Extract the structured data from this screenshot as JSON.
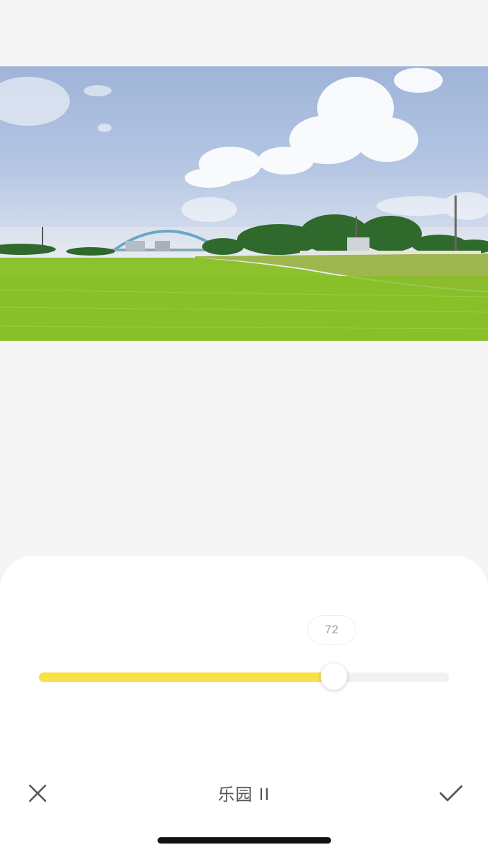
{
  "photo": {
    "description_icon": "landscape-photo"
  },
  "adjust": {
    "value_label": "72",
    "value": 72,
    "min": 0,
    "max": 100,
    "accent_color": "#f7e14a"
  },
  "toolbar": {
    "filter_name": "乐园 II",
    "cancel_icon": "close-icon",
    "confirm_icon": "check-icon"
  }
}
